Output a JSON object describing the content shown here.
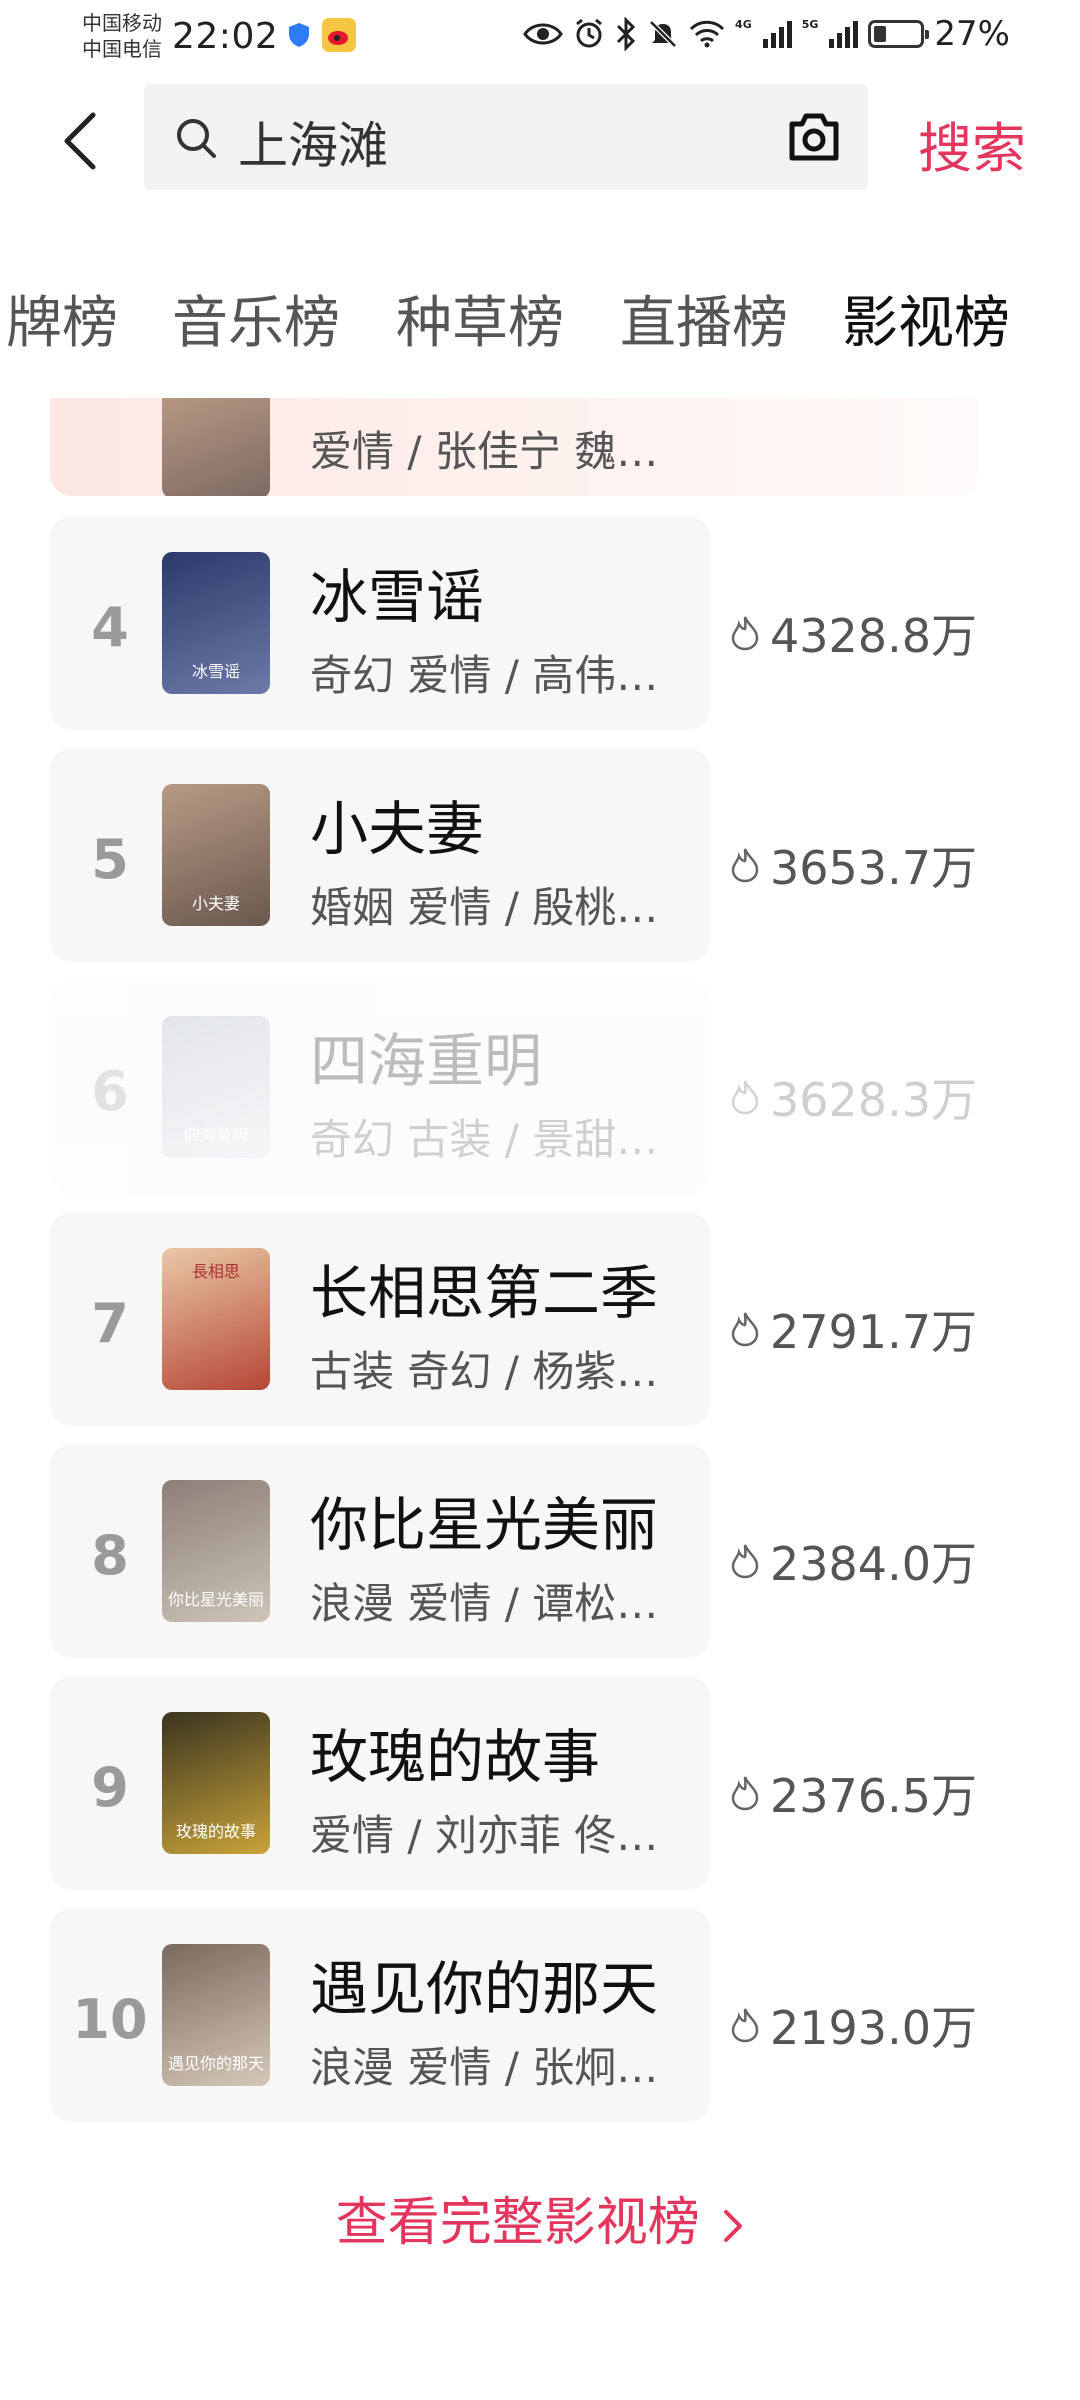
{
  "status": {
    "carrier1": "中国移动",
    "carrier2": "中国电信",
    "time": "22:02",
    "net1": "4G",
    "net2": "5G",
    "battery_level": 0.27,
    "battery": "27%"
  },
  "search": {
    "query": "上海滩",
    "button": "搜索"
  },
  "tabs": [
    {
      "label": "牌榜",
      "active": false
    },
    {
      "label": "音乐榜",
      "active": false
    },
    {
      "label": "种草榜",
      "active": false
    },
    {
      "label": "直播榜",
      "active": false
    },
    {
      "label": "影视榜",
      "active": true
    }
  ],
  "ranks": [
    {
      "rank": "",
      "title": "",
      "tags": "爱情 / 张佳宁 魏…",
      "heat": "",
      "poster_colors": [
        "#c7a58c",
        "#7d6a63"
      ],
      "poster_text": ""
    },
    {
      "rank": "4",
      "title": "冰雪谣",
      "tags": "奇幻 爱情 / 高伟…",
      "heat": "4328.8万",
      "poster_colors": [
        "#2b3a6b",
        "#6d7aa8"
      ],
      "poster_text": "冰雪谣"
    },
    {
      "rank": "5",
      "title": "小夫妻",
      "tags": "婚姻 爱情 / 殷桃…",
      "heat": "3653.7万",
      "poster_colors": [
        "#b89b86",
        "#6a584e"
      ],
      "poster_text": "小夫妻"
    },
    {
      "rank": "6",
      "title": "四海重明",
      "tags": "奇幻 古装 / 景甜…",
      "heat": "3628.3万",
      "poster_colors": [
        "#9aa4b4",
        "#e0e2e8"
      ],
      "poster_text": "四海重明"
    },
    {
      "rank": "7",
      "title": "长相思第二季",
      "tags": "古装 奇幻 / 杨紫…",
      "heat": "2791.7万",
      "poster_colors": [
        "#e9c9a6",
        "#b64636"
      ],
      "poster_text": "長相思"
    },
    {
      "rank": "8",
      "title": "你比星光美丽",
      "tags": "浪漫 爱情 / 谭松…",
      "heat": "2384.0万",
      "poster_colors": [
        "#8b7f77",
        "#cfc4b8"
      ],
      "poster_text": "你比星光美丽"
    },
    {
      "rank": "9",
      "title": "玫瑰的故事",
      "tags": "爱情 / 刘亦菲 佟…",
      "heat": "2376.5万",
      "poster_colors": [
        "#3a3420",
        "#c9a43a"
      ],
      "poster_text": "玫瑰的故事"
    },
    {
      "rank": "10",
      "title": "遇见你的那天",
      "tags": "浪漫 爱情 / 张炯…",
      "heat": "2193.0万",
      "poster_colors": [
        "#7a6a5e",
        "#d6c8b8"
      ],
      "poster_text": "遇见你的那天"
    }
  ],
  "full_link": "查看完整影视榜",
  "colors": {
    "accent": "#e3365e",
    "row_bg": "#f7f7f7",
    "rank_gray": "#9a9a9a"
  }
}
